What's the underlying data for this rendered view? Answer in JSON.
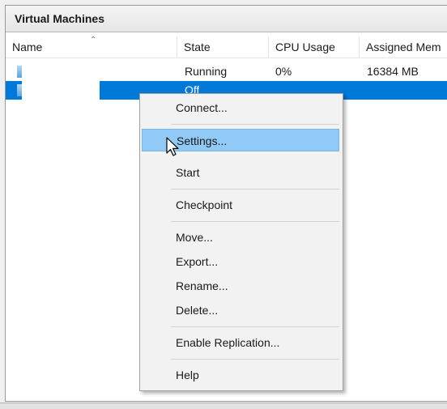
{
  "panel": {
    "title": "Virtual Machines"
  },
  "columns": [
    {
      "label": "Name"
    },
    {
      "label": "State"
    },
    {
      "label": "CPU Usage"
    },
    {
      "label": "Assigned Mem"
    }
  ],
  "vms": [
    {
      "name": "",
      "state": "Running",
      "cpu": "0%",
      "memory": "16384 MB"
    },
    {
      "name": "",
      "state": "Off",
      "cpu": "",
      "memory": ""
    }
  ],
  "context_menu": {
    "items": [
      {
        "label": "Connect..."
      },
      {
        "label": "Settings..."
      },
      {
        "label": "Start"
      },
      {
        "label": "Checkpoint"
      },
      {
        "label": "Move..."
      },
      {
        "label": "Export..."
      },
      {
        "label": "Rename..."
      },
      {
        "label": "Delete..."
      },
      {
        "label": "Enable Replication..."
      },
      {
        "label": "Help"
      }
    ],
    "hovered": "Settings..."
  },
  "colors": {
    "selection": "#0078d7",
    "menu_hover": "#91c9f7"
  },
  "icons": {
    "vm": "vm-icon",
    "pointer": "mouse-pointer-icon"
  }
}
